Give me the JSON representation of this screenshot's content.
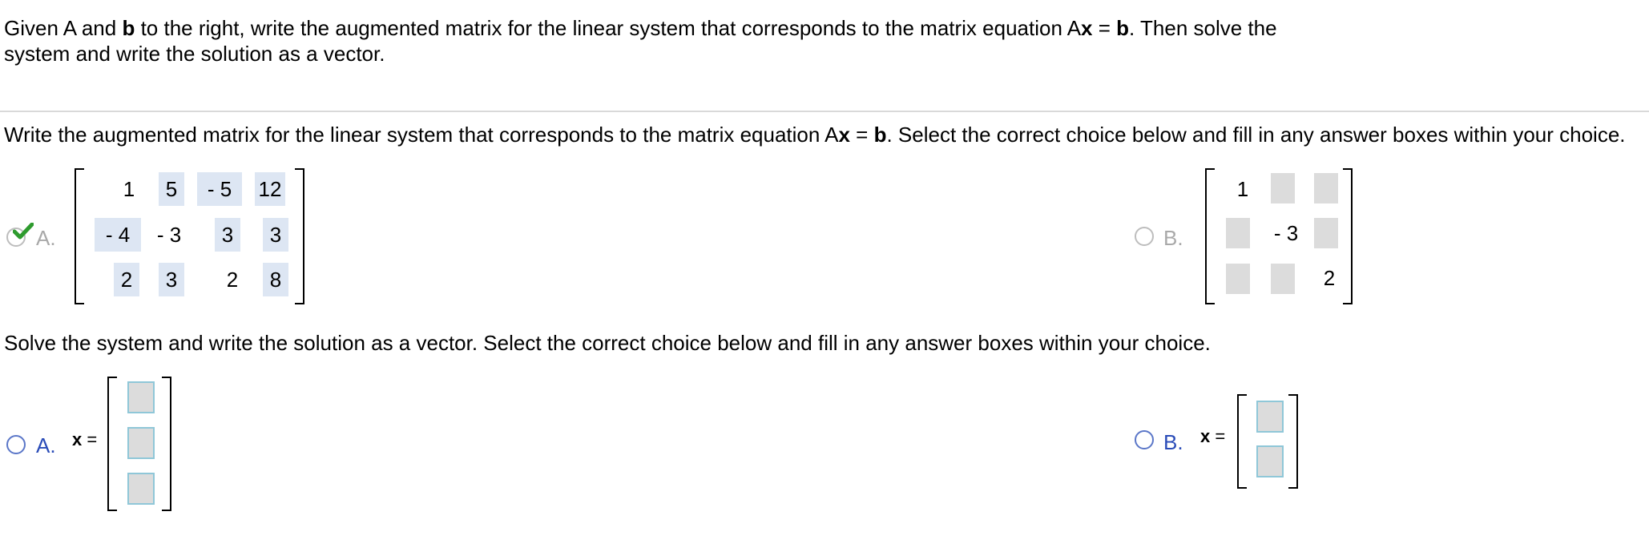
{
  "intro": {
    "line1_a": "Given A and ",
    "line1_b": "b",
    "line1_c": " to the right, write the augmented matrix for the linear system that corresponds to the matrix equation A",
    "line1_d": "x",
    "line1_e": " = ",
    "line1_f": "b",
    "line1_g": ". Then solve the",
    "line2": "system and write the solution as a vector."
  },
  "q1": {
    "prompt_a": "Write the augmented matrix for the linear system that corresponds to the matrix equation A",
    "prompt_b": "x",
    "prompt_c": " = ",
    "prompt_d": "b",
    "prompt_e": ". Select the correct choice below and fill in any answer boxes within your choice.",
    "choiceA": {
      "label": "A.",
      "selected": true,
      "correct": true,
      "matrix": [
        [
          "1",
          "5",
          "- 5",
          "12"
        ],
        [
          "- 4",
          "- 3",
          "3",
          "3"
        ],
        [
          "2",
          "3",
          "2",
          "8"
        ]
      ]
    },
    "choiceB": {
      "label": "B.",
      "matrix_values": {
        "r1c1": "1",
        "r2c3": "- 3",
        "r3c4": "2"
      }
    }
  },
  "q2": {
    "prompt": "Solve the system and write the solution as a vector. Select the correct choice below and fill in any answer boxes within your choice.",
    "choiceA": {
      "label": "A.",
      "lhs_x": "x",
      "lhs_eq": " ="
    },
    "choiceB": {
      "label": "B.",
      "lhs_x": "x",
      "lhs_eq": " ="
    }
  },
  "colors": {
    "highlight": "#dde6f3",
    "radio_blue": "#5a76c8",
    "label_blue": "#2a4cb8",
    "check_green": "#2e9b2e",
    "box_grey": "#dcdcdc",
    "box_border": "#8fc7d8"
  }
}
